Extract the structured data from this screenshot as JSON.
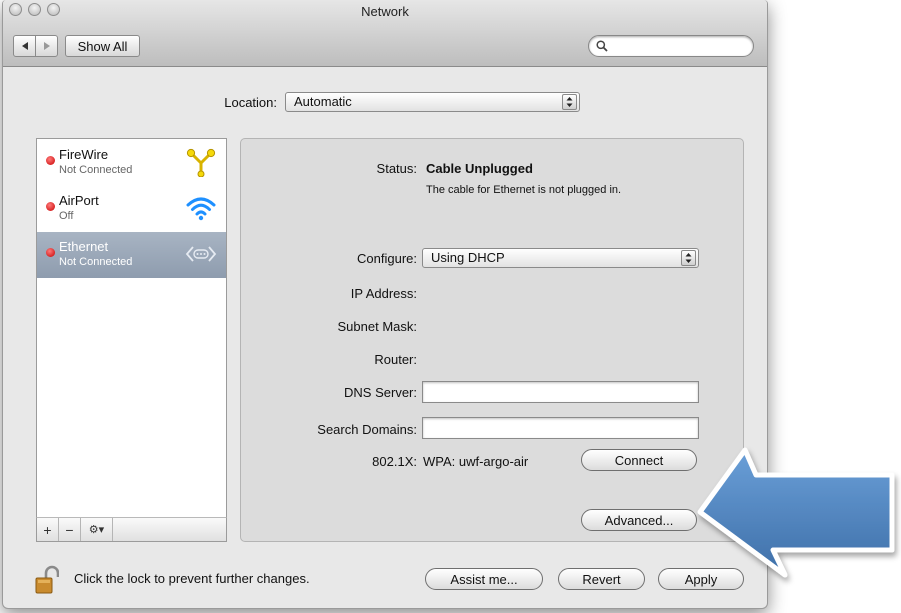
{
  "window": {
    "title": "Network"
  },
  "toolbar": {
    "show_all_label": "Show All",
    "search_placeholder": "",
    "back_icon": "back-arrow-icon",
    "forward_icon": "forward-arrow-icon"
  },
  "location": {
    "label": "Location:",
    "value": "Automatic"
  },
  "services": [
    {
      "name": "FireWire",
      "status": "Not Connected",
      "icon": "firewire-icon",
      "selected": false
    },
    {
      "name": "AirPort",
      "status": "Off",
      "icon": "wifi-icon",
      "selected": false
    },
    {
      "name": "Ethernet",
      "status": "Not Connected",
      "icon": "ethernet-icon",
      "selected": true
    }
  ],
  "sidebar_buttons": {
    "add": "+",
    "remove": "−",
    "action": "⚙▾"
  },
  "detail": {
    "status_label": "Status:",
    "status_value": "Cable Unplugged",
    "status_desc": "The cable for Ethernet is not plugged in.",
    "configure_label": "Configure:",
    "configure_value": "Using DHCP",
    "ip_label": "IP Address:",
    "subnet_label": "Subnet Mask:",
    "router_label": "Router:",
    "dns_label": "DNS Server:",
    "dns_value": "",
    "search_domains_label": "Search Domains:",
    "search_domains_value": "",
    "dot1x_label": "802.1X:",
    "dot1x_value": "WPA: uwf-argo-air",
    "connect_label": "Connect",
    "advanced_label": "Advanced..."
  },
  "bottom": {
    "lock_text": "Click the lock to prevent further changes.",
    "assist_label": "Assist me...",
    "revert_label": "Revert",
    "apply_label": "Apply"
  },
  "colors": {
    "status_red": "#d40000",
    "selection": "#8e9cae",
    "arrow_blue": "#4f81bd"
  }
}
